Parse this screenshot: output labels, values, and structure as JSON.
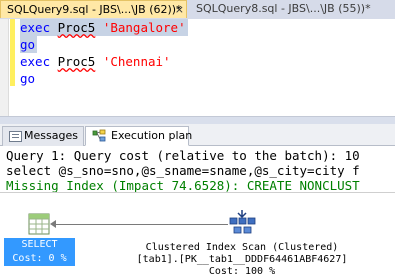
{
  "tabs": [
    {
      "label": "SQLQuery9.sql - JBS\\...\\JB (62))*",
      "close": "×"
    },
    {
      "label": "SQLQuery8.sql - JBS\\...\\JB (55))*"
    }
  ],
  "editor": {
    "lines": [
      {
        "kw": "exec",
        "proc": "Proc5",
        "str": "'Bangalore'"
      },
      {
        "kw": "go"
      },
      {
        "kw": "exec",
        "proc": "Proc5",
        "str": "'Chennai'"
      },
      {
        "kw": "go"
      }
    ]
  },
  "result_tabs": {
    "messages": "Messages",
    "plan": "Execution plan"
  },
  "plan": {
    "query_cost": "Query 1: Query cost (relative to the batch): 10",
    "statement": "select @s_sno=sno,@s_sname=sname,@s_city=city f",
    "missing_index": "Missing Index (Impact 74.6528): CREATE NONCLUST",
    "select_label": "SELECT",
    "select_cost": "Cost: 0 %",
    "scan_title": "Clustered Index Scan (Clustered)",
    "scan_object": "[tab1].[PK__tab1__DDDF64461ABF4627]",
    "scan_cost": "Cost: 100 %"
  },
  "colors": {
    "keyword": "#0000ff",
    "string": "#ff0000",
    "missing_index": "#008000",
    "selected_operator": "#3399ff",
    "active_tab": "#ffe8a6"
  },
  "icons": {
    "messages_tab": "messages-icon",
    "plan_tab": "execution-plan-icon",
    "select_operator": "select-operator-icon",
    "scan_operator": "clustered-index-scan-icon"
  }
}
